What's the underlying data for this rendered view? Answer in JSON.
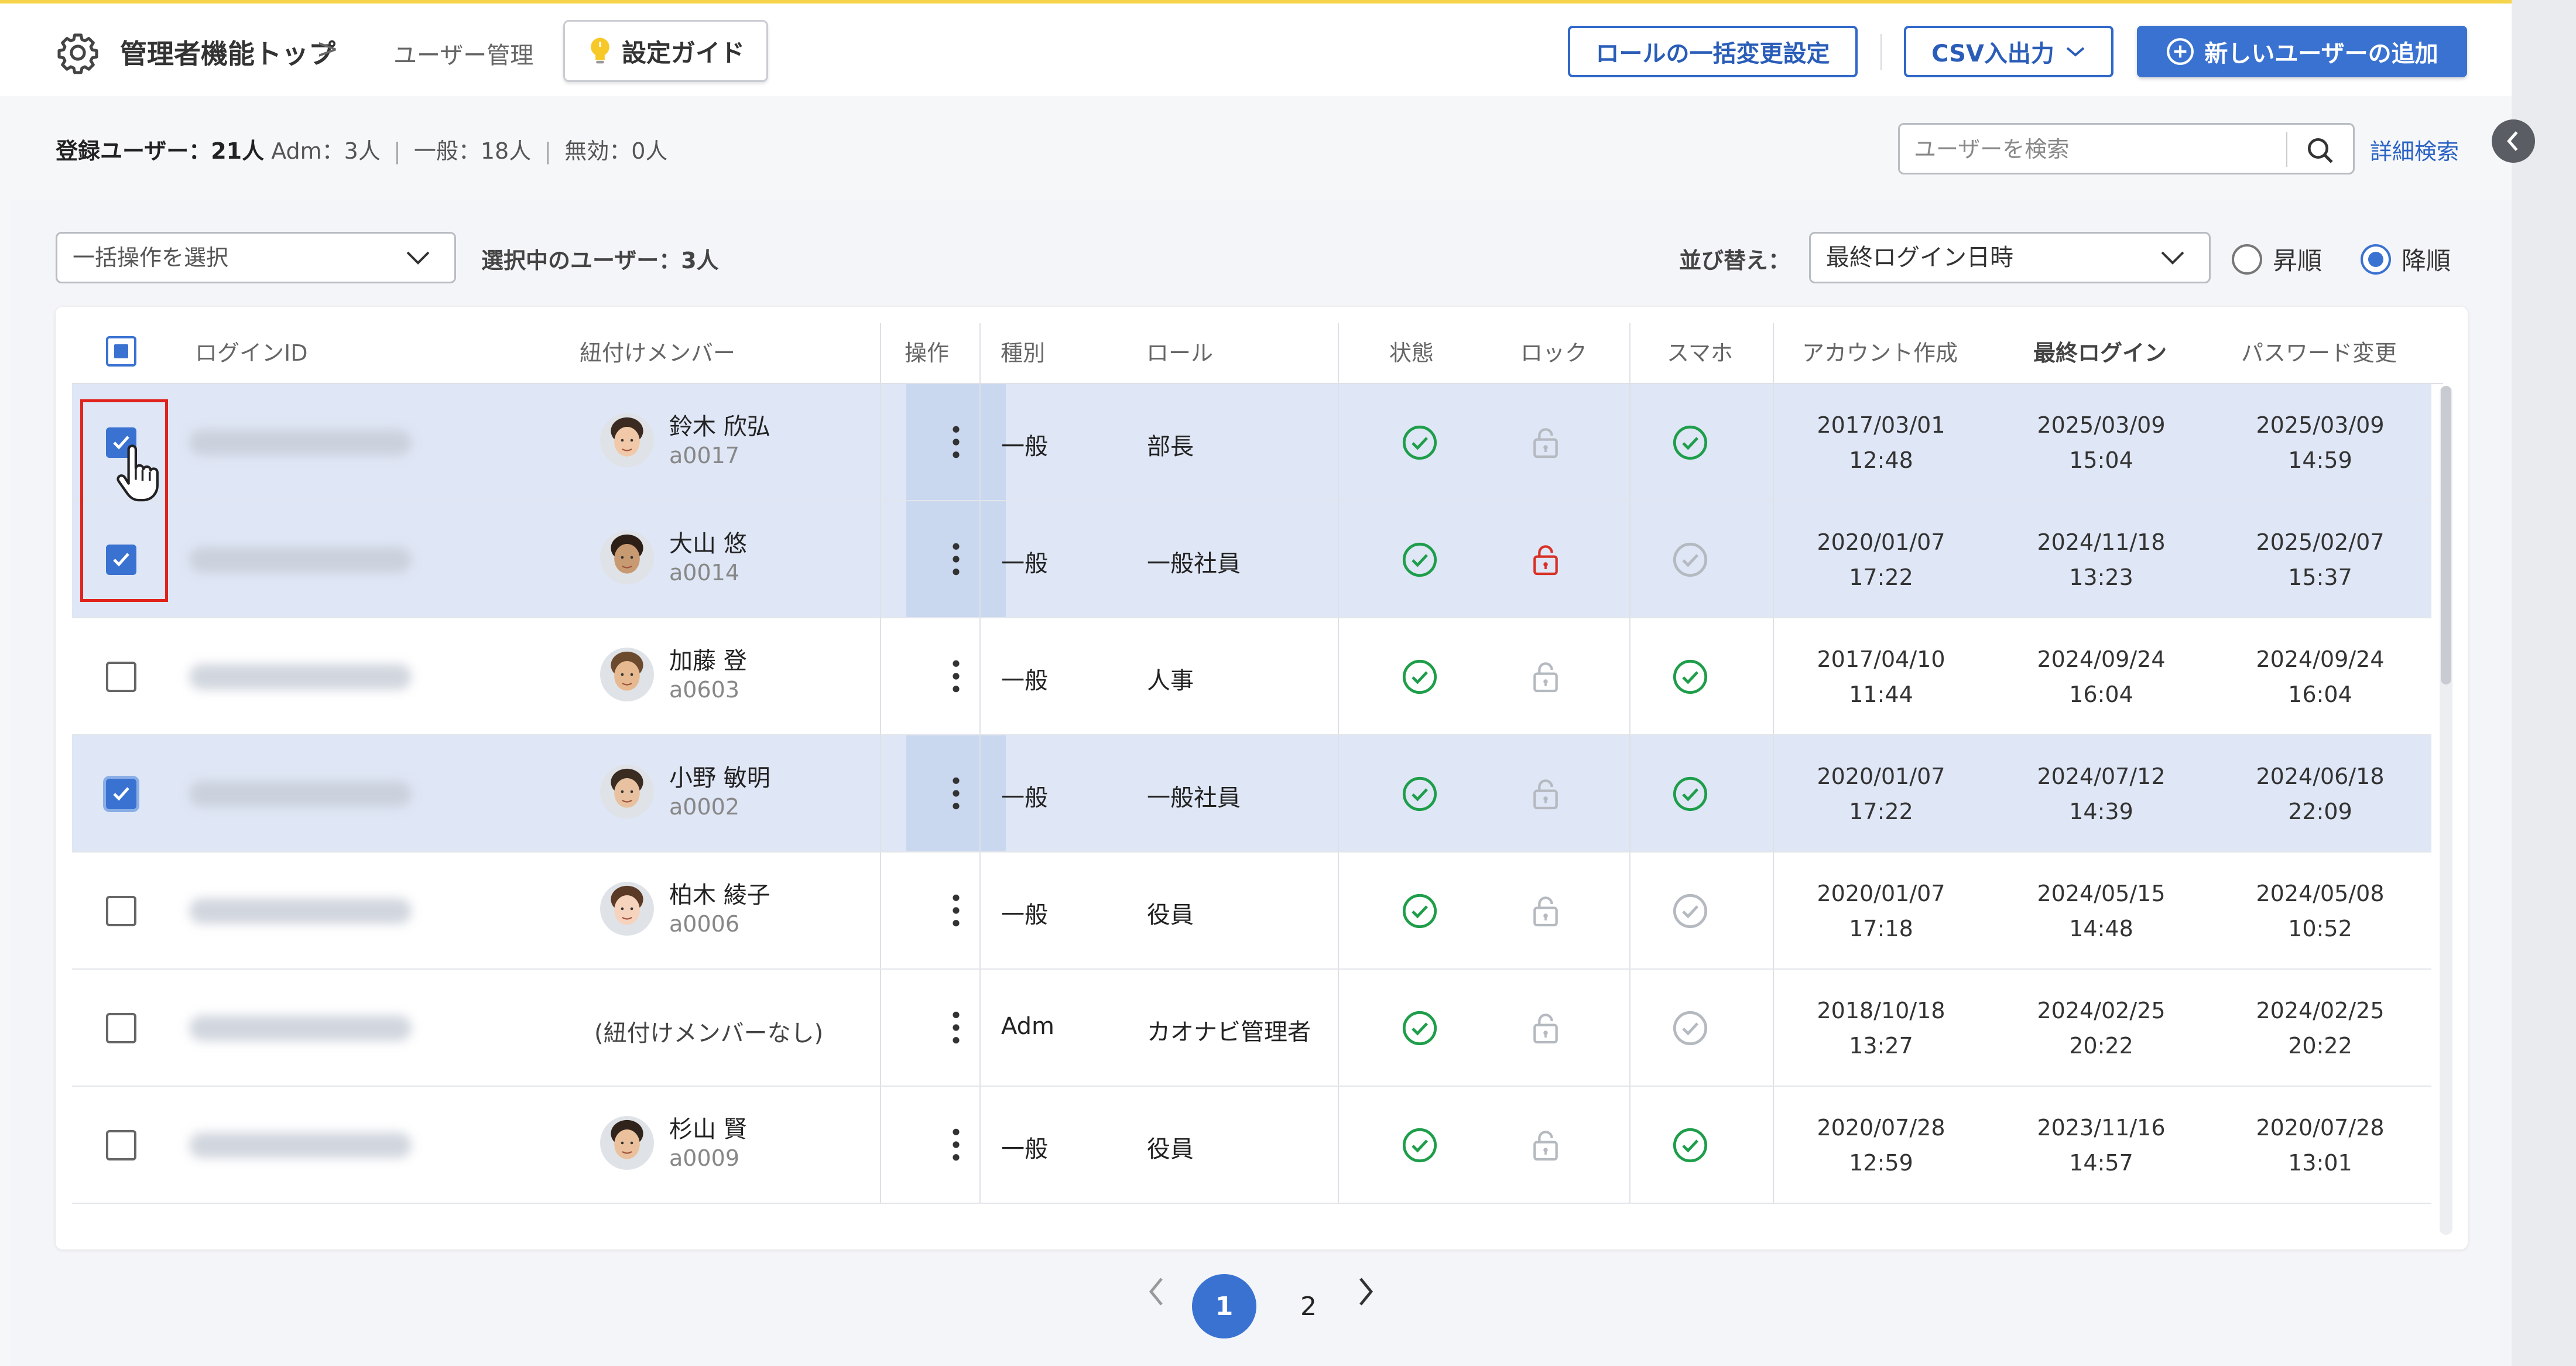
{
  "header": {
    "title": "管理者機能トップ",
    "separator": ">",
    "crumb": "ユーザー管理",
    "guide_label": "設定ガイド",
    "role_bulk_label": "ロールの一括変更設定",
    "csv_label": "CSV入出力",
    "add_user_label": "新しいユーザーの追加"
  },
  "stats": {
    "registered_label": "登録ユーザー：21人",
    "adm": "Adm：3人",
    "general": "一般：18人",
    "invalid": "無効：0人",
    "divider": "|"
  },
  "search": {
    "placeholder": "ユーザーを検索",
    "advanced_label": "詳細検索"
  },
  "toolbar": {
    "bulk_placeholder": "一括操作を選択",
    "selected_label": "選択中のユーザー：3人",
    "sort_label": "並び替え：",
    "sort_value": "最終ログイン日時",
    "asc_label": "昇順",
    "desc_label": "降順"
  },
  "table": {
    "columns": {
      "login_id": "ログインID",
      "member": "紐付けメンバー",
      "operation": "操作",
      "type": "種別",
      "role": "ロール",
      "status": "状態",
      "lock": "ロック",
      "phone": "スマホ",
      "created": "アカウント作成",
      "last_login": "最終ログイン",
      "pw_change": "パスワード変更"
    },
    "rows": [
      {
        "checked": true,
        "member_name": "鈴木 欣弘",
        "member_id": "a0017",
        "type": "一般",
        "role": "部長",
        "status": "active",
        "lock": "unlocked",
        "phone": "enabled",
        "created_date": "2017/03/01",
        "created_time": "12:48",
        "login_date": "2025/03/09",
        "login_time": "15:04",
        "pw_date": "2025/03/09",
        "pw_time": "14:59"
      },
      {
        "checked": true,
        "member_name": "大山 悠",
        "member_id": "a0014",
        "type": "一般",
        "role": "一般社員",
        "status": "active",
        "lock": "locked",
        "phone": "disabled",
        "created_date": "2020/01/07",
        "created_time": "17:22",
        "login_date": "2024/11/18",
        "login_time": "13:23",
        "pw_date": "2025/02/07",
        "pw_time": "15:37"
      },
      {
        "checked": false,
        "member_name": "加藤 登",
        "member_id": "a0603",
        "type": "一般",
        "role": "人事",
        "status": "active",
        "lock": "unlocked",
        "phone": "enabled",
        "created_date": "2017/04/10",
        "created_time": "11:44",
        "login_date": "2024/09/24",
        "login_time": "16:04",
        "pw_date": "2024/09/24",
        "pw_time": "16:04"
      },
      {
        "checked": true,
        "member_name": "小野 敏明",
        "member_id": "a0002",
        "type": "一般",
        "role": "一般社員",
        "status": "active",
        "lock": "unlocked",
        "phone": "enabled",
        "created_date": "2020/01/07",
        "created_time": "17:22",
        "login_date": "2024/07/12",
        "login_time": "14:39",
        "pw_date": "2024/06/18",
        "pw_time": "22:09"
      },
      {
        "checked": false,
        "member_name": "柏木 綾子",
        "member_id": "a0006",
        "type": "一般",
        "role": "役員",
        "status": "active",
        "lock": "unlocked",
        "phone": "disabled",
        "created_date": "2020/01/07",
        "created_time": "17:18",
        "login_date": "2024/05/15",
        "login_time": "14:48",
        "pw_date": "2024/05/08",
        "pw_time": "10:52"
      },
      {
        "checked": false,
        "member_name": "",
        "member_id": "",
        "no_member": "(紐付けメンバーなし)",
        "type": "Adm",
        "role": "カオナビ管理者",
        "status": "active",
        "lock": "unlocked",
        "phone": "disabled",
        "created_date": "2018/10/18",
        "created_time": "13:27",
        "login_date": "2024/02/25",
        "login_time": "20:22",
        "pw_date": "2024/02/25",
        "pw_time": "20:22"
      },
      {
        "checked": false,
        "member_name": "杉山 賢",
        "member_id": "a0009",
        "type": "一般",
        "role": "役員",
        "status": "active",
        "lock": "unlocked",
        "phone": "enabled",
        "created_date": "2020/07/28",
        "created_time": "12:59",
        "login_date": "2023/11/16",
        "login_time": "14:57",
        "pw_date": "2020/07/28",
        "pw_time": "13:01"
      }
    ]
  },
  "pagination": {
    "pages": [
      "1",
      "2"
    ],
    "current": "1"
  },
  "colors": {
    "accent": "#3a72d1",
    "selected_row": "#dfe6f5",
    "ok_green": "#1e9e4a",
    "lock_red": "#d93025",
    "highlight_red": "#e0241c"
  }
}
